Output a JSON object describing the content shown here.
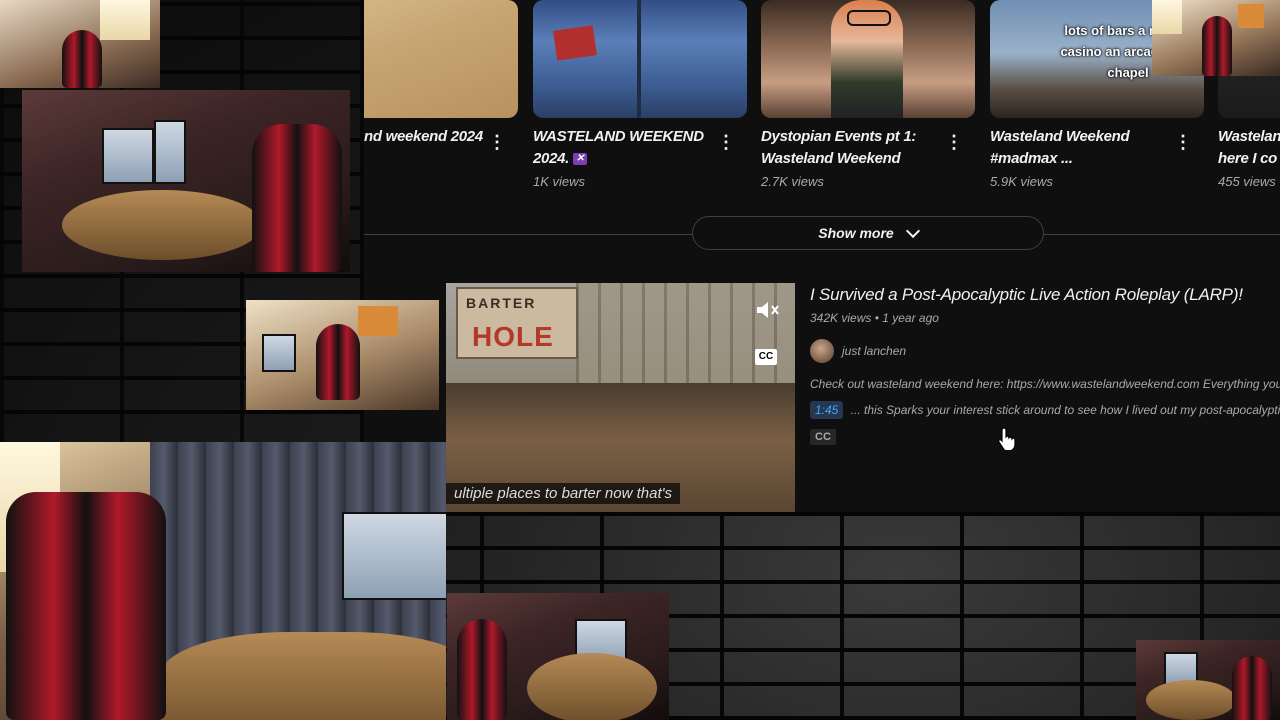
{
  "related_videos": [
    {
      "title": "nd weekend 2024",
      "views": "",
      "has_badge": false,
      "thumb": "desert"
    },
    {
      "title": "WASTELAND WEEKEND 2024.",
      "views": "1K views",
      "has_badge": true,
      "thumb": "jacket"
    },
    {
      "title": "Dystopian Events pt 1: Wasteland Weekend",
      "views": "2.7K views",
      "has_badge": false,
      "thumb": "person"
    },
    {
      "title": "Wasteland Weekend #madmax ...",
      "views": "5.9K views",
      "has_badge": false,
      "thumb": "caption",
      "thumb_caption": "lots of bars a market casino an arcade an a chapel"
    },
    {
      "title": "Wastelan here I co",
      "views": "455 views",
      "has_badge": false,
      "thumb": "cam"
    }
  ],
  "show_more_label": "Show more",
  "featured": {
    "title": "I Survived a Post-Apocalyptic Live Action Roleplay (LARP)!",
    "meta": "342K views • 1 year ago",
    "channel": "just lanchen",
    "description": "Check out wasteland weekend here: https://www.wastelandweekend.com Everything you see",
    "timestamp": "1:45",
    "timestamp_text": "... this Sparks your interest stick around to see how I lived out my post-apocalyptic dre",
    "cc_label": "CC",
    "player": {
      "subtitle": "ultiple places to barter now that's",
      "sign_top": "BARTER",
      "sign_main": "HOLE",
      "cc_button": "CC",
      "mute_icon": "muted-speaker-icon"
    }
  },
  "colors": {
    "background": "#0f0f0f",
    "text_primary": "#f1f1f1",
    "text_secondary": "#aaaaaa",
    "link_blue": "#3ea6ff",
    "badge_purple": "#7b3fb3"
  }
}
